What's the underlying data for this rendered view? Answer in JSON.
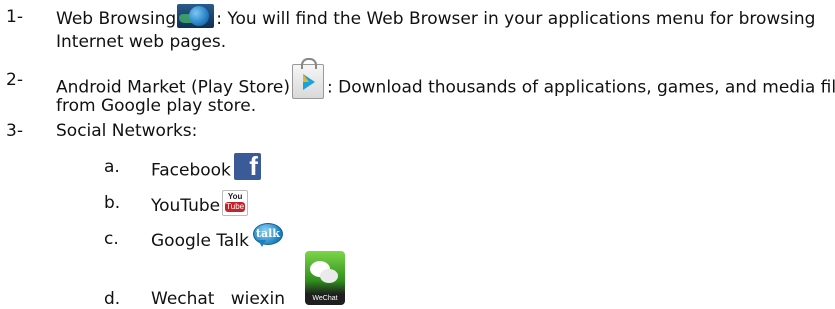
{
  "items": [
    {
      "num": "1-",
      "before": "Web Browsing",
      "after": ": You will find the Web Browser in your applications menu for browsing",
      "cont": "Internet web pages.",
      "icon": "web-browser-icon"
    },
    {
      "num": "2-",
      "before": "Android Market (Play Store)",
      "after": ": Download thousands of applications, games, and media files",
      "cont": "from Google play store.",
      "icon": "play-store-icon"
    },
    {
      "num": "3-",
      "text": "Social Networks:"
    }
  ],
  "sub_items": [
    {
      "letter": "a.",
      "text": "Facebook",
      "icon": "facebook-icon"
    },
    {
      "letter": "b.",
      "text": "YouTube",
      "icon": "youtube-icon"
    },
    {
      "letter": "c.",
      "text": "Google Talk",
      "icon": "google-talk-icon"
    },
    {
      "letter": "d.",
      "text": "Wechat   wiexin",
      "icon": "wechat-icon",
      "icon_label": "WeChat"
    }
  ],
  "icon_text": {
    "youtube_top": "You",
    "youtube_bottom": "Tube",
    "talk": "talk"
  }
}
